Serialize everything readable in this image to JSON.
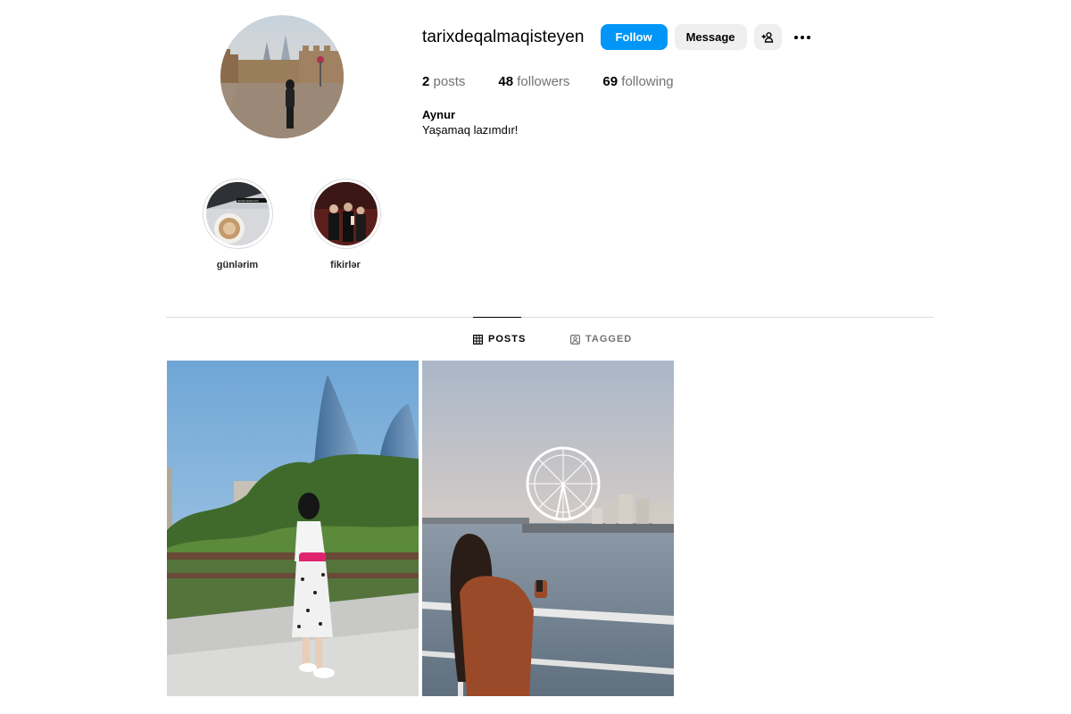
{
  "profile": {
    "username": "tarixdeqalmaqisteyen",
    "full_name": "Aynur",
    "bio": "Yaşamaq lazımdır!"
  },
  "actions": {
    "follow_label": "Follow",
    "message_label": "Message"
  },
  "stats": {
    "posts_count": "2",
    "posts_label": "posts",
    "followers_count": "48",
    "followers_label": "followers",
    "following_count": "69",
    "following_label": "following"
  },
  "highlights": [
    {
      "label": "günlərim",
      "overlay_text": "günlərimizdən biri"
    },
    {
      "label": "fikirlər"
    }
  ],
  "tabs": [
    {
      "label": "POSTS",
      "icon": "grid-icon",
      "active": true
    },
    {
      "label": "TAGGED",
      "icon": "tagged-icon",
      "active": false
    }
  ],
  "colors": {
    "follow_button": "#0095f6",
    "secondary_button": "#efefef",
    "muted_text": "#737373",
    "divider": "#dbdbdb"
  },
  "icons": {
    "add_user": "person-plus-icon",
    "more": "more-options-icon"
  },
  "posts": [
    {
      "image": "woman-in-front-of-flame-towers-photo"
    },
    {
      "image": "woman-by-sea-with-ferris-wheel-photo"
    }
  ]
}
